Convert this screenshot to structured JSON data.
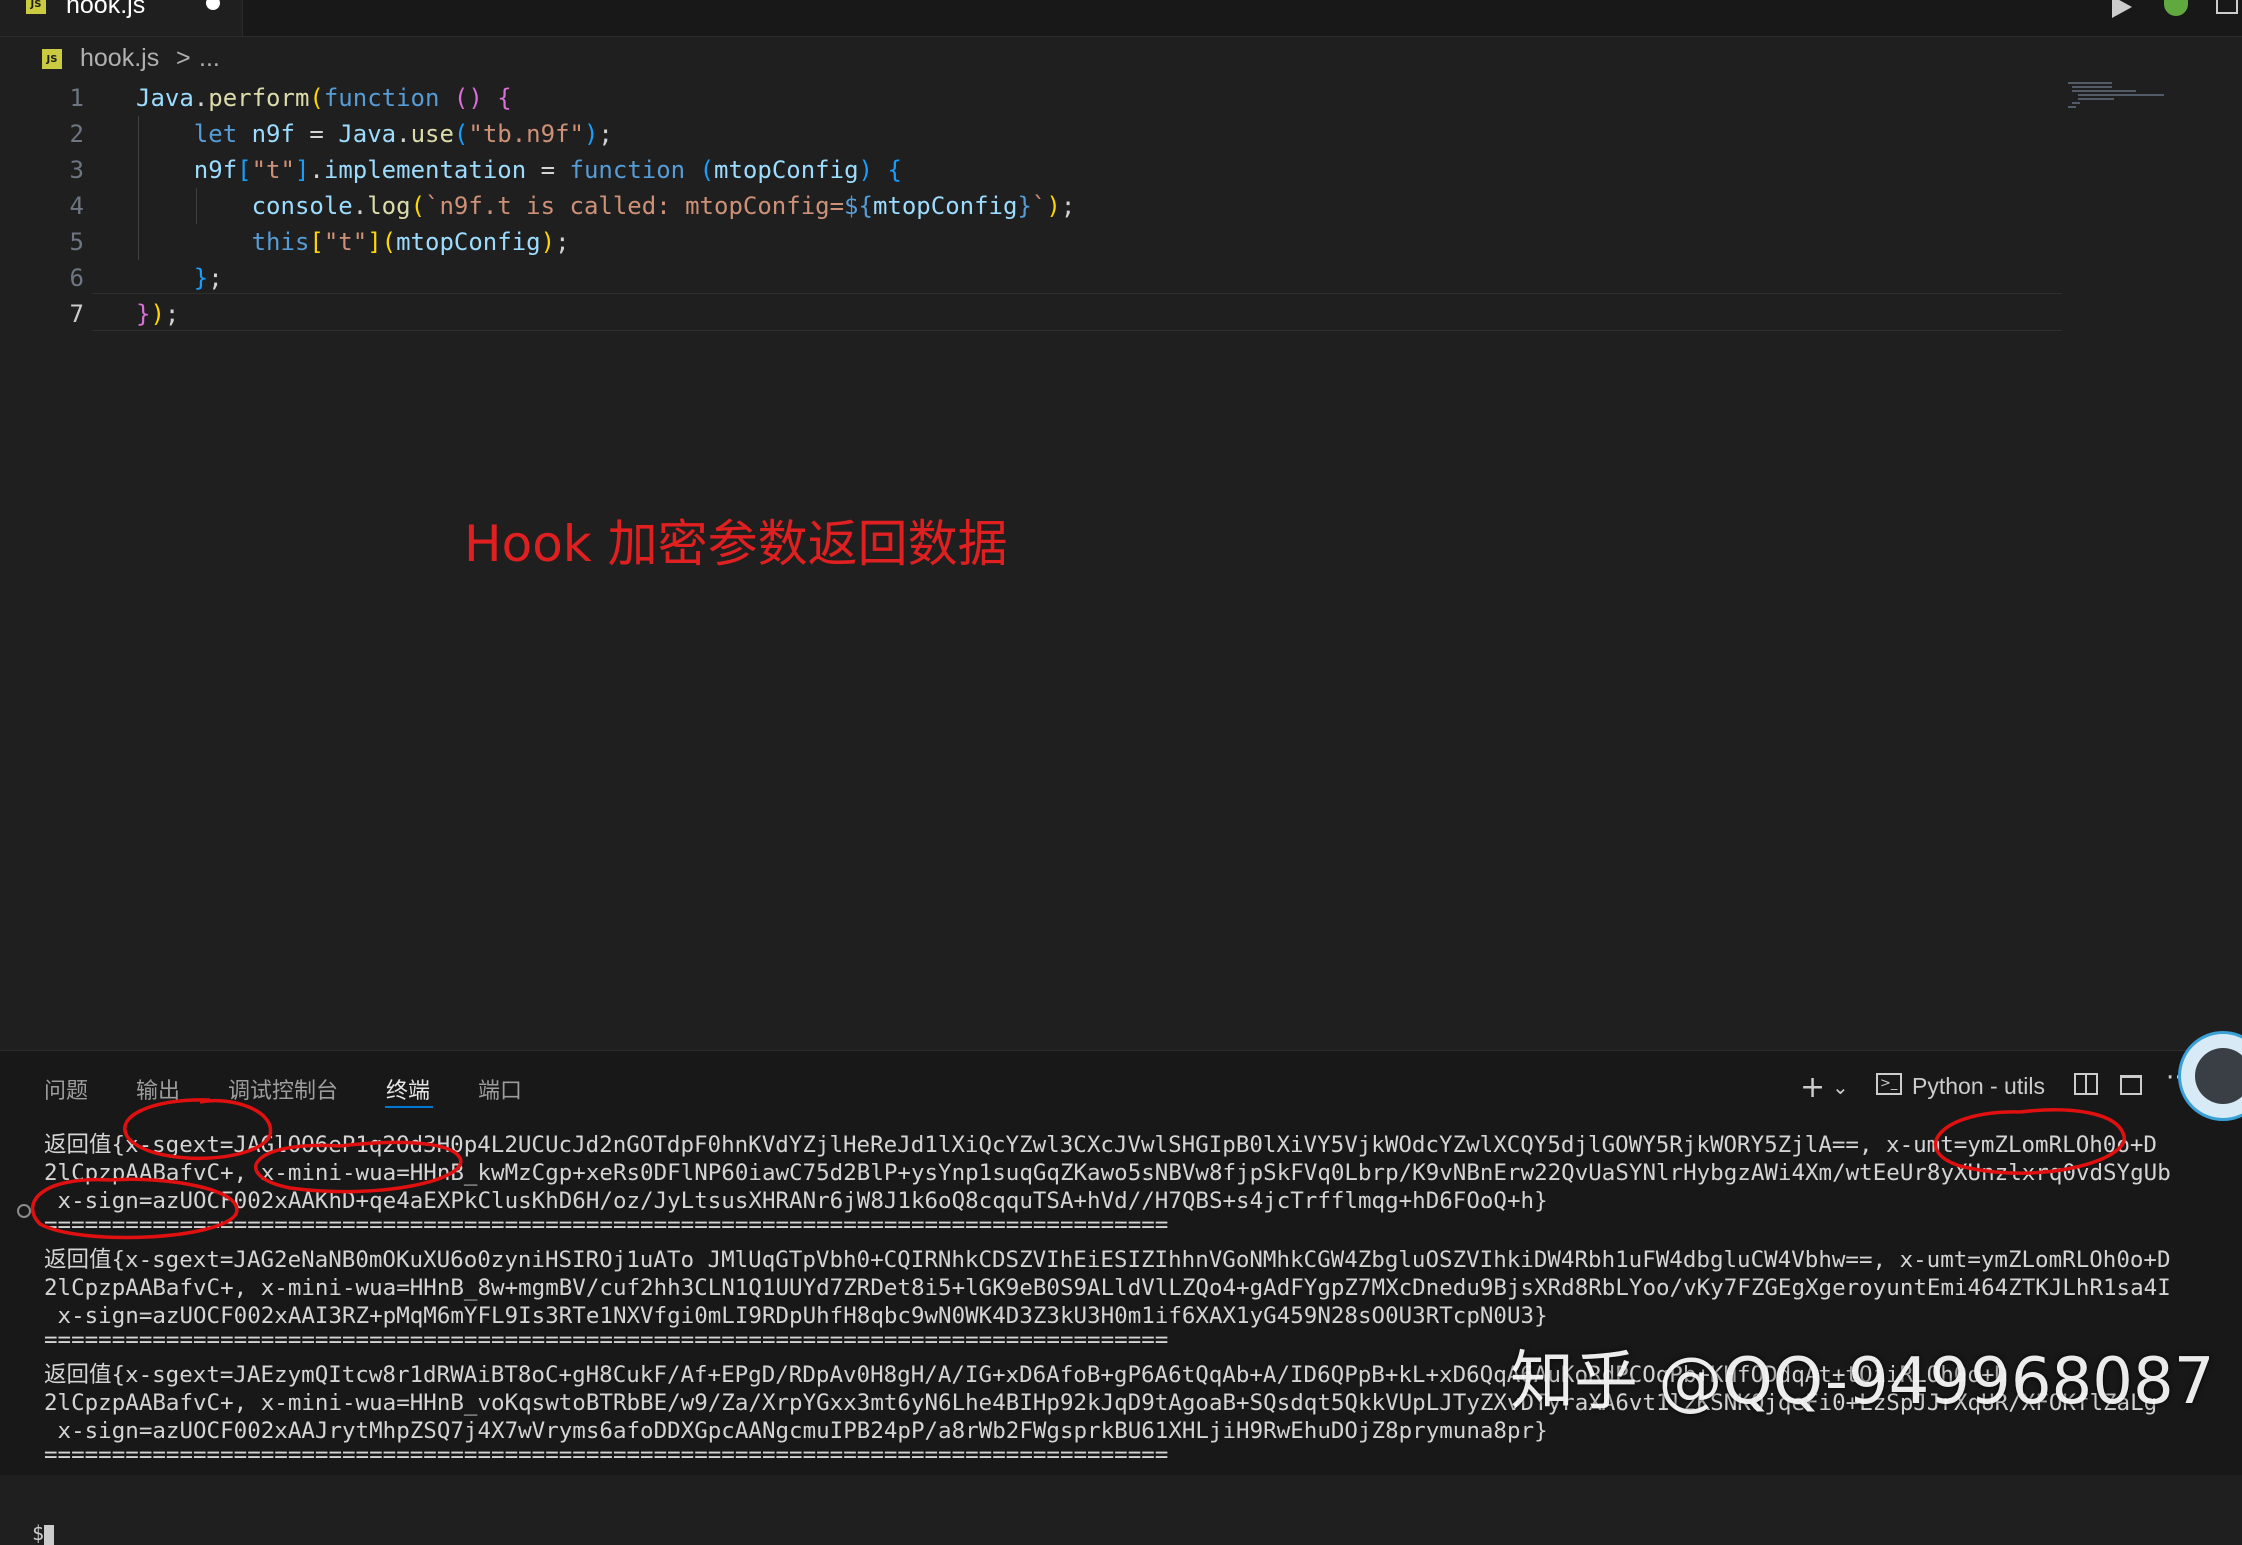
{
  "tab": {
    "label": "hook.js",
    "badge": "JS"
  },
  "breadcrumb": {
    "file": "hook.js",
    "separator": ">",
    "more": "..."
  },
  "editor": {
    "line_numbers": [
      "1",
      "2",
      "3",
      "4",
      "5",
      "6",
      "7"
    ],
    "lines": [
      [
        {
          "t": "Java",
          "c": "t-v"
        },
        {
          "t": ".",
          "c": "t-p"
        },
        {
          "t": "perform",
          "c": "t-f"
        },
        {
          "t": "(",
          "c": "t-b1"
        },
        {
          "t": "function",
          "c": "t-k"
        },
        {
          "t": " ",
          "c": "t-p"
        },
        {
          "t": "()",
          "c": "t-b2"
        },
        {
          "t": " ",
          "c": "t-p"
        },
        {
          "t": "{",
          "c": "t-b2"
        }
      ],
      [
        {
          "t": "    ",
          "c": "t-p"
        },
        {
          "t": "let",
          "c": "t-k"
        },
        {
          "t": " n9f ",
          "c": "t-v"
        },
        {
          "t": "= ",
          "c": "t-p"
        },
        {
          "t": "Java",
          "c": "t-v"
        },
        {
          "t": ".",
          "c": "t-p"
        },
        {
          "t": "use",
          "c": "t-f"
        },
        {
          "t": "(",
          "c": "t-b3"
        },
        {
          "t": "\"tb.n9f\"",
          "c": "t-s"
        },
        {
          "t": ")",
          "c": "t-b3"
        },
        {
          "t": ";",
          "c": "t-p"
        }
      ],
      [
        {
          "t": "    ",
          "c": "t-p"
        },
        {
          "t": "n9f",
          "c": "t-v"
        },
        {
          "t": "[",
          "c": "t-b3"
        },
        {
          "t": "\"t\"",
          "c": "t-s"
        },
        {
          "t": "]",
          "c": "t-b3"
        },
        {
          "t": ".",
          "c": "t-p"
        },
        {
          "t": "implementation",
          "c": "t-v"
        },
        {
          "t": " = ",
          "c": "t-p"
        },
        {
          "t": "function",
          "c": "t-k"
        },
        {
          "t": " ",
          "c": "t-p"
        },
        {
          "t": "(",
          "c": "t-b3"
        },
        {
          "t": "mtopConfig",
          "c": "t-v"
        },
        {
          "t": ")",
          "c": "t-b3"
        },
        {
          "t": " ",
          "c": "t-p"
        },
        {
          "t": "{",
          "c": "t-b3"
        }
      ],
      [
        {
          "t": "        ",
          "c": "t-p"
        },
        {
          "t": "console",
          "c": "t-v"
        },
        {
          "t": ".",
          "c": "t-p"
        },
        {
          "t": "log",
          "c": "t-f"
        },
        {
          "t": "(",
          "c": "t-b1"
        },
        {
          "t": "`n9f.t is called: mtopConfig=",
          "c": "t-s"
        },
        {
          "t": "${",
          "c": "t-k"
        },
        {
          "t": "mtopConfig",
          "c": "t-v"
        },
        {
          "t": "}",
          "c": "t-k"
        },
        {
          "t": "`",
          "c": "t-s"
        },
        {
          "t": ")",
          "c": "t-b1"
        },
        {
          "t": ";",
          "c": "t-p"
        }
      ],
      [
        {
          "t": "        ",
          "c": "t-p"
        },
        {
          "t": "this",
          "c": "t-k"
        },
        {
          "t": "[",
          "c": "t-b1"
        },
        {
          "t": "\"t\"",
          "c": "t-s"
        },
        {
          "t": "]",
          "c": "t-b1"
        },
        {
          "t": "(",
          "c": "t-b1"
        },
        {
          "t": "mtopConfig",
          "c": "t-v"
        },
        {
          "t": ")",
          "c": "t-b1"
        },
        {
          "t": ";",
          "c": "t-p"
        }
      ],
      [
        {
          "t": "    ",
          "c": "t-p"
        },
        {
          "t": "}",
          "c": "t-b3"
        },
        {
          "t": ";",
          "c": "t-p"
        }
      ],
      [
        {
          "t": "}",
          "c": "t-b2"
        },
        {
          "t": ")",
          "c": "t-b1"
        },
        {
          "t": ";",
          "c": "t-p"
        }
      ]
    ]
  },
  "annotation": "Hook 加密参数返回数据",
  "panel": {
    "tabs": [
      "问题",
      "输出",
      "调试控制台",
      "终端",
      "端口"
    ],
    "active_tab": "终端",
    "terminal_name": "Python - utils",
    "terminal_lines": [
      "返回值{x-sgext=JAGlOO6eP1q2Od3H0p4L2UCUcJd2nGOTdpF0hnKVdYZjlHeReJd1lXiQcYZwl3CXcJVwlSHGIpB0lXiVY5VjkWOdcYZwlXCQY5djlGOWY5RjkWORY5ZjlA==, x-umt=ymZLomRLOh0o+D",
      "2lCpzpAABafvC+, x-mini-wua=HHnB_kwMzCgp+xeRs0DFlNP60iawC75d2BlP+ysYnp1suqGqZKawo5sNBVw8fjpSkFVq0Lbrp/K9vNBnErw22QvUaSYNlrHybgzAWi4Xm/wtEeUr8yXUnzlxrq0vdSYgUb",
      " x-sign=azUOCF002xAAKhD+qe4aEXPkClusKhD6H/oz/JyLtsusXHRANr6jW8J1k6oQ8cqquTSA+hVd//H7QBS+s4jcTrfflmqg+hD6FOoQ+h}",
      "===================================================================================",
      "返回值{x-sgext=JAG2eNaNB0mOKuXU6o0zyniHSIROj1uATo JMlUqGTpVbh0+CQIRNhkCDSZVIhEiESIZIhhnVGoNMhkCGW4ZbgluOSZVIhkiDW4Rbh1uFW4dbgluCW4Vbhw==, x-umt=ymZLomRLOh0o+D",
      "2lCpzpAABafvC+, x-mini-wua=HHnB_8w+mgmBV/cuf2hh3CLN1Q1UUYd7ZRDet8i5+lGK9eB0S9ALldVlLZQo4+gAdFYgpZ7MXcDnedu9BjsXRd8RbLYoo/vKy7FZGEgXgeroyuntEmi464ZTKJLhR1sa4I",
      " x-sign=azUOCF002xAAI3RZ+pMqM6mYFL9Is3RTe1NXVfgi0mLI9RDpUhfH8qbc9wN0WK4D3Z3kU3H0m1if6XAX1yG459N28sO0U3RTcpN0U3}",
      "===================================================================================",
      "返回值{x-sgext=JAEzymQItcw8r1dRWAiBT8oC+gH8CukF/Af+EPgD/RDpAv0H8gH/A/IG+xD6AfoB+gP6A6tQqAb+A/ID6QPpB+kL+xD6QqA6AuKoRdPCOqPb+KHfODdqAt+tQiiRLOh0o+D",
      "2lCpzpAABafvC+, x-mini-wua=HHnB_voKqswtoBTRbBE/w9/Za/XrpYGxx3mt6yN6Lhe4BIHp92kJqD9tAgoaB+SQsdqt5QkkVUpLJTyZXvDTyraXA6vt1lzKSNKOjqeFi0+LzSpJJrXqUR/XFOKflZaLg",
      " x-sign=azUOCF002xAAJrytMhpZSQ7j4X7wVryms6afoDDXGpcAANgcmuIPB24pP/a8rWb2FWgsprkBU61XHLjiH9RwEhuDOjZ8prymuna8pr}",
      "==================================================================================="
    ]
  },
  "watermark": "知乎 @QQ-949968087",
  "colors": {
    "annotation": "#e02020",
    "accent": "#0078d4",
    "circle": "#e01010"
  }
}
